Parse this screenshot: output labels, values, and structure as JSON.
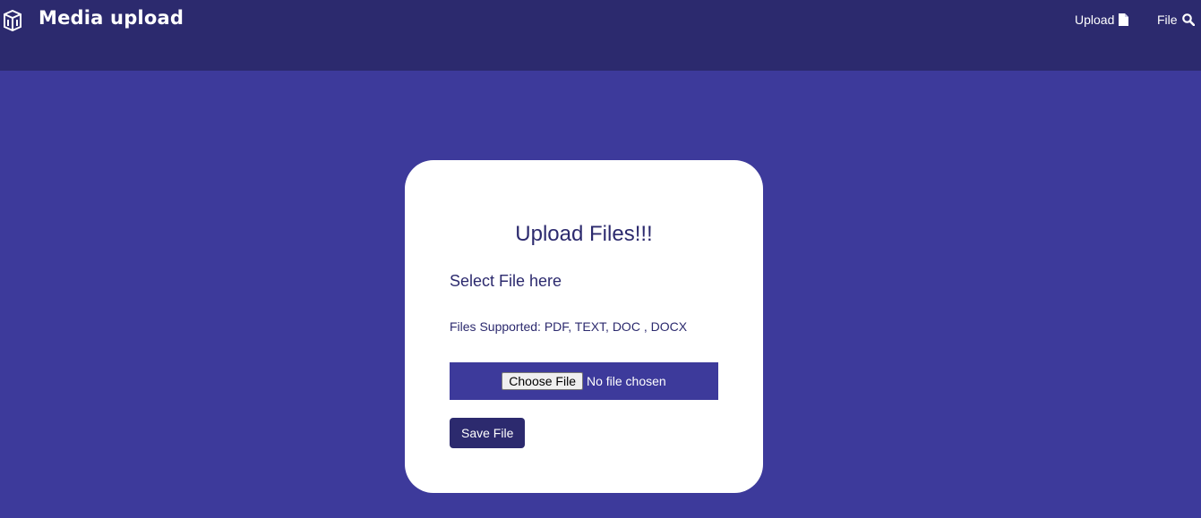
{
  "navbar": {
    "logo_icon": "cube-logo-icon",
    "title": "Media upload",
    "links": [
      {
        "label": "Upload",
        "icon": "file-icon"
      },
      {
        "label": "File",
        "icon": "search-icon"
      }
    ]
  },
  "card": {
    "title": "Upload Files!!!",
    "select_label": "Select File here",
    "supported_text": "Files Supported: PDF, TEXT, DOC , DOCX",
    "file_input": {
      "button_label": "Choose File",
      "status_text": "No file chosen"
    },
    "save_label": "Save File"
  },
  "colors": {
    "navbar_bg": "#2c2a6e",
    "page_bg": "#3d3a9b",
    "card_bg": "#ffffff",
    "accent_text": "#2c2a6e"
  }
}
